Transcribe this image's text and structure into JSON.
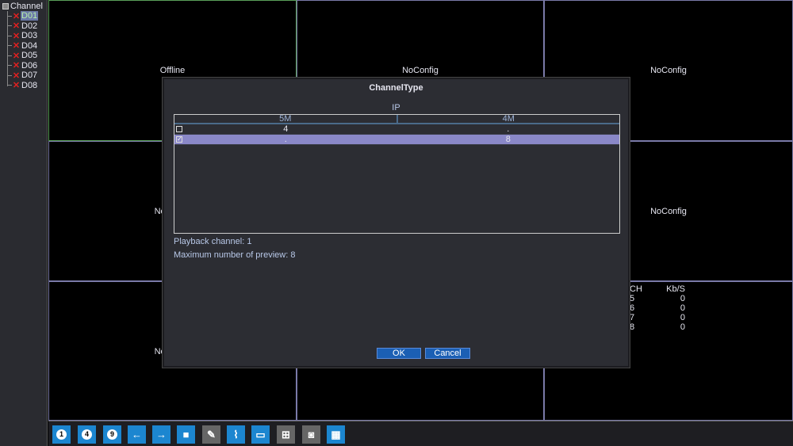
{
  "sidebar": {
    "title": "Channel",
    "items": [
      {
        "label": "D01",
        "selected": true
      },
      {
        "label": "D02"
      },
      {
        "label": "D03"
      },
      {
        "label": "D04"
      },
      {
        "label": "D05"
      },
      {
        "label": "D06"
      },
      {
        "label": "D07"
      },
      {
        "label": "D08"
      }
    ]
  },
  "grid": {
    "cells": [
      "Offline",
      "NoConfig",
      "NoConfig",
      "NoConfig",
      "",
      "NoConfig",
      "NoConfig",
      "",
      ""
    ]
  },
  "stats": {
    "headers": [
      "CH",
      "Kb/S"
    ],
    "rows": [
      [
        "5",
        "0"
      ],
      [
        "6",
        "0"
      ],
      [
        "7",
        "0"
      ],
      [
        "8",
        "0"
      ]
    ]
  },
  "dialog": {
    "title": "ChannelType",
    "group": "IP",
    "columns": [
      "5M",
      "4M"
    ],
    "rows": [
      {
        "checked": false,
        "values": [
          "4",
          "."
        ]
      },
      {
        "checked": true,
        "values": [
          ".",
          "8"
        ],
        "selected": true
      }
    ],
    "playback": "Playback channel: 1",
    "max_preview": "Maximum number of preview: 8",
    "ok": "OK",
    "cancel": "Cancel"
  },
  "toolbar": {
    "items": [
      {
        "icon": "split-1-icon",
        "label": "1"
      },
      {
        "icon": "split-4-icon",
        "label": "4"
      },
      {
        "icon": "split-9-icon",
        "label": "9"
      },
      {
        "icon": "arrow-left-icon",
        "label": "←"
      },
      {
        "icon": "arrow-right-icon",
        "label": "→"
      },
      {
        "icon": "fullscreen-icon",
        "label": "■"
      },
      {
        "icon": "ptz-camera-icon",
        "label": "✎"
      },
      {
        "icon": "chart-icon",
        "label": "⌇"
      },
      {
        "icon": "monitor-icon",
        "label": "▭"
      },
      {
        "icon": "network-icon",
        "label": "⊞"
      },
      {
        "icon": "hdd-icon",
        "label": "◙"
      },
      {
        "icon": "qr-code-icon",
        "label": "▦"
      }
    ]
  },
  "colors": {
    "accent": "#1c86d0",
    "selected_row": "#8a88c8",
    "grid_line": "#7a7aa8",
    "active_cell": "#5aa05a"
  }
}
